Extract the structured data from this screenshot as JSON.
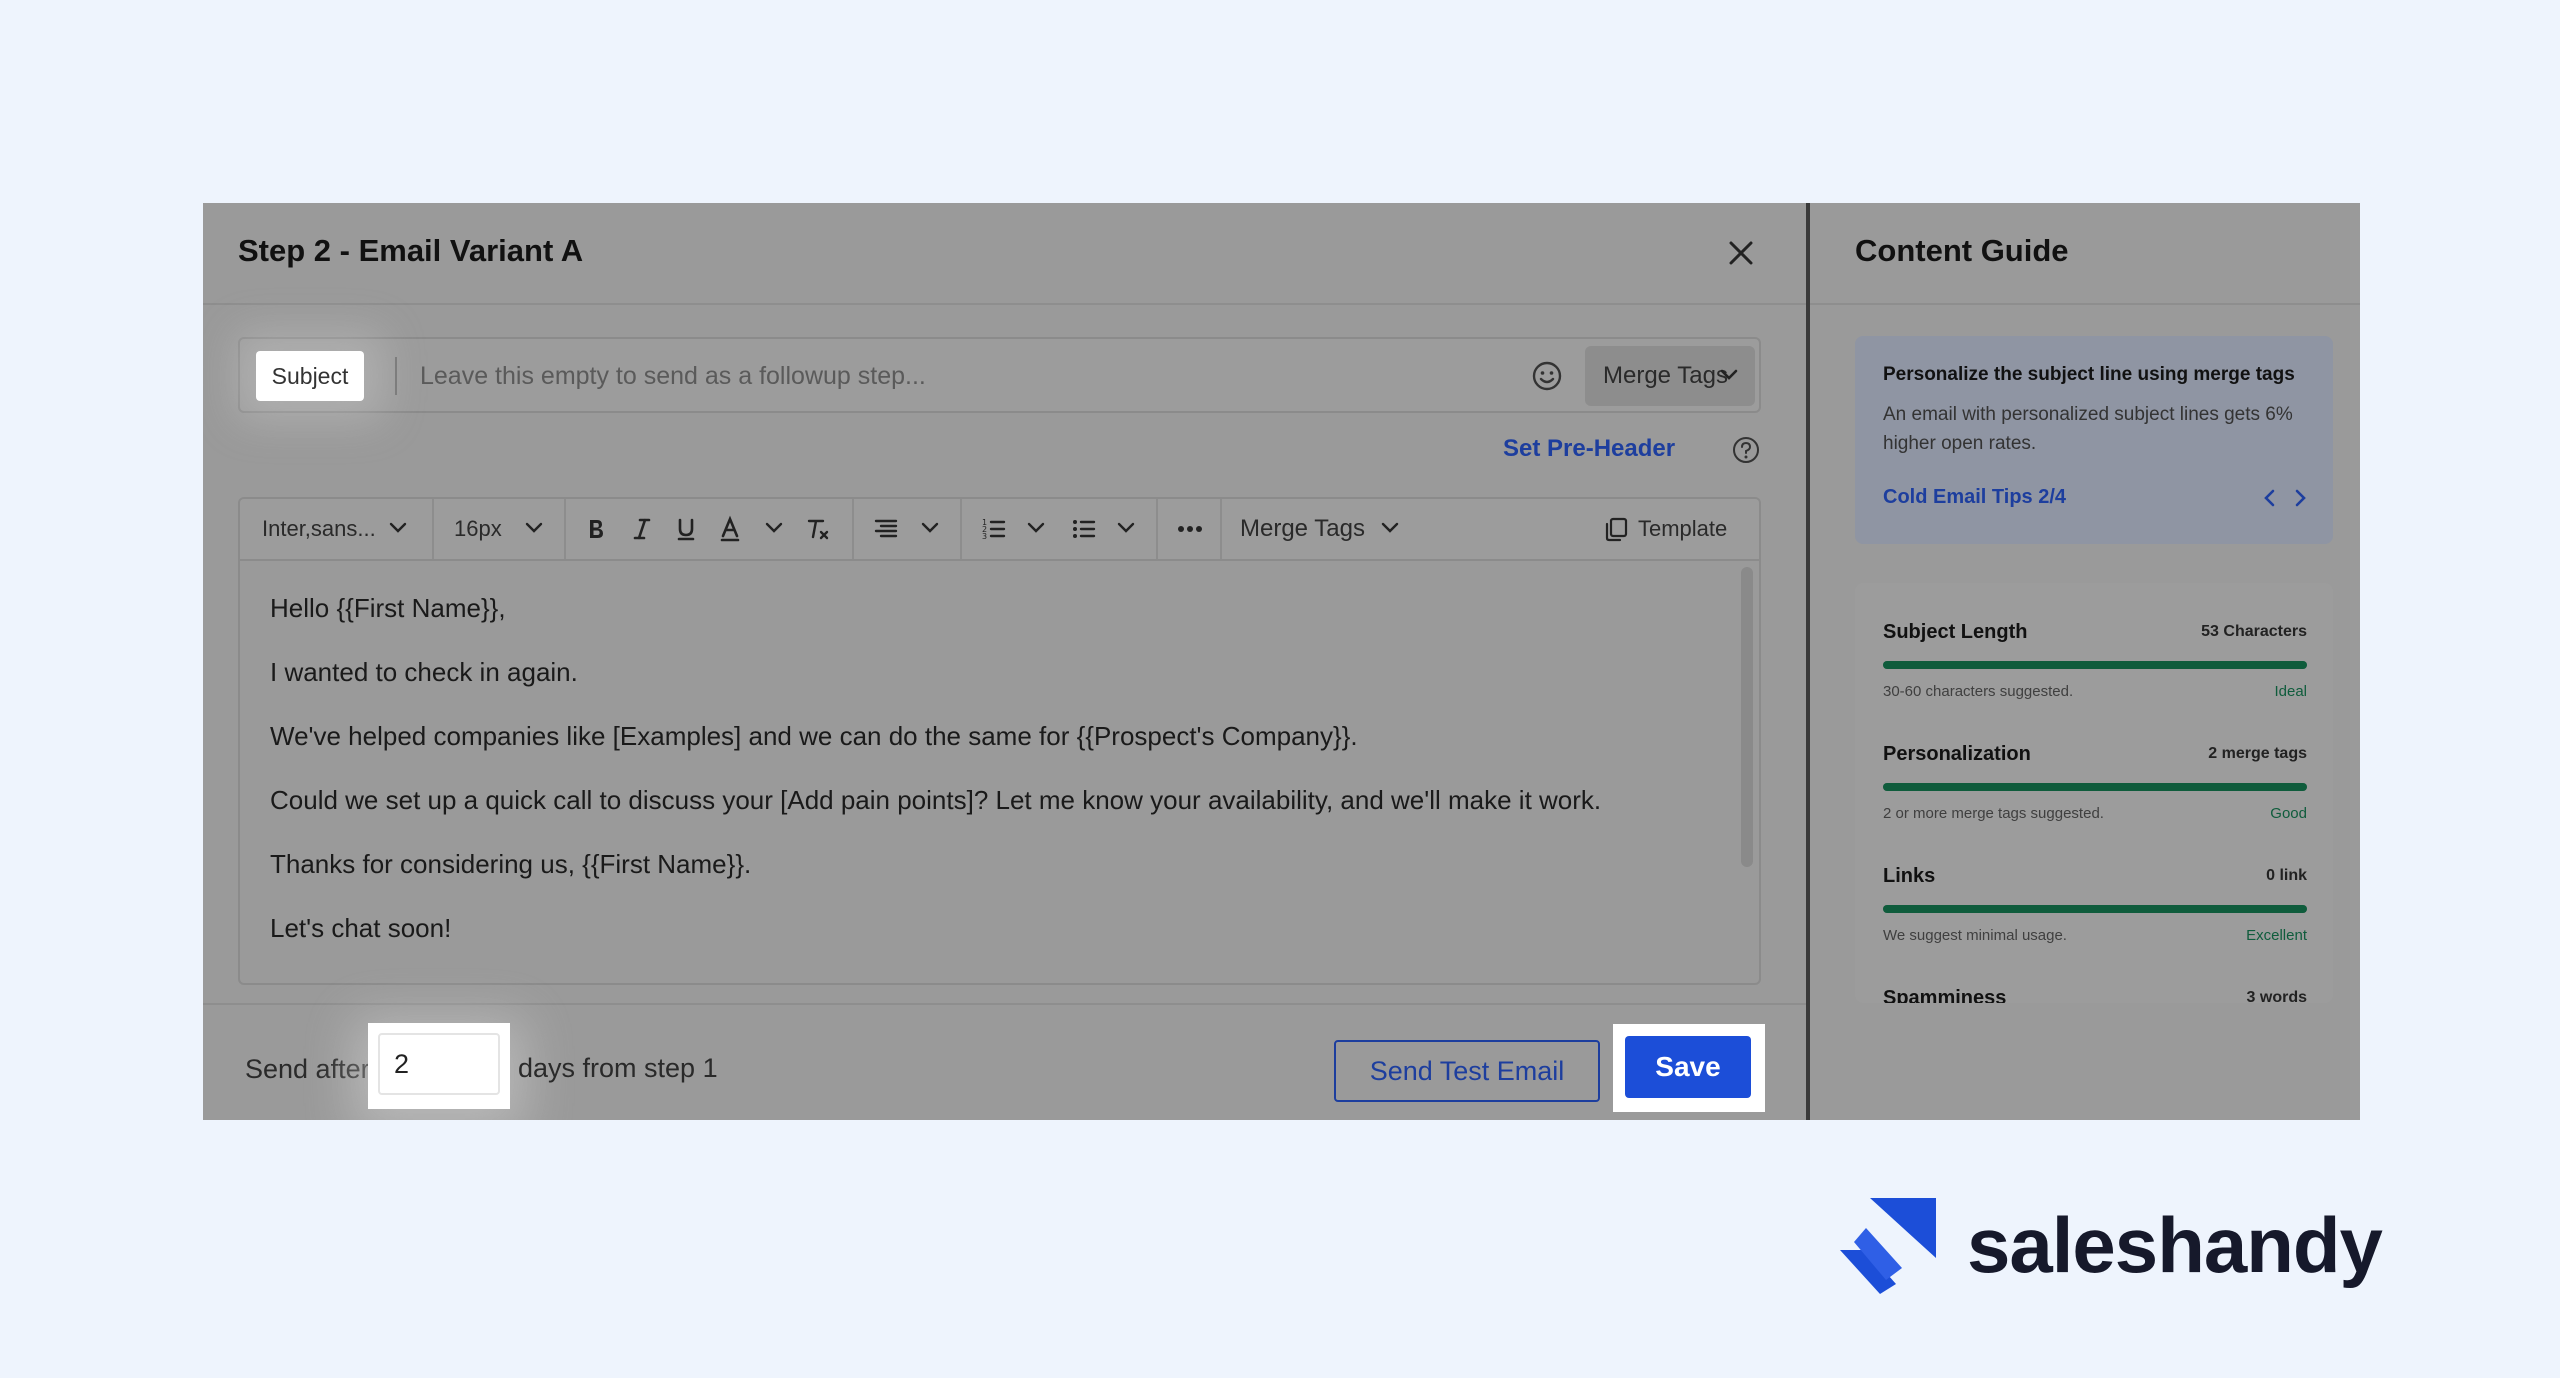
{
  "editor": {
    "title": "Step 2 - Email Variant A",
    "subject_label": "Subject",
    "subject_placeholder": "Leave this empty to send as a followup step...",
    "subject_merge_tags": "Merge Tags",
    "set_preheader": "Set Pre-Header",
    "toolbar": {
      "font_family": "Inter,sans...",
      "font_size": "16px",
      "merge_tags": "Merge Tags",
      "template": "Template"
    },
    "body_lines": [
      "Hello {{First Name}},",
      "I wanted to check in again.",
      "We've helped companies like [Examples] and we can do the same for {{Prospect's Company}}.",
      "Could we set up a quick call to discuss your [Add pain points]? Let me know your availability, and we'll make it work.",
      "Thanks for considering us, {{First Name}}.",
      "Let's chat soon!"
    ]
  },
  "footer": {
    "send_after": "Send after",
    "days_value": "2",
    "days_from": "days from step 1",
    "send_test": "Send Test Email",
    "save": "Save"
  },
  "guide": {
    "title": "Content Guide",
    "tip": {
      "title": "Personalize the subject line using merge tags",
      "text": "An email with personalized subject lines gets 6% higher open rates.",
      "link": "Cold Email Tips 2/4"
    },
    "metrics": [
      {
        "name": "Subject Length",
        "value": "53 Characters",
        "hint": "30-60 characters suggested.",
        "status": "Ideal",
        "fill": 1.0
      },
      {
        "name": "Personalization",
        "value": "2 merge tags",
        "hint": "2 or more merge tags suggested.",
        "status": "Good",
        "fill": 1.0
      },
      {
        "name": "Links",
        "value": "0 link",
        "hint": "We suggest minimal usage.",
        "status": "Excellent",
        "fill": 1.0
      },
      {
        "name": "Spamminess",
        "value": "3 words"
      }
    ]
  },
  "brand": {
    "name": "saleshandy",
    "accent": "#1c4ed8"
  }
}
